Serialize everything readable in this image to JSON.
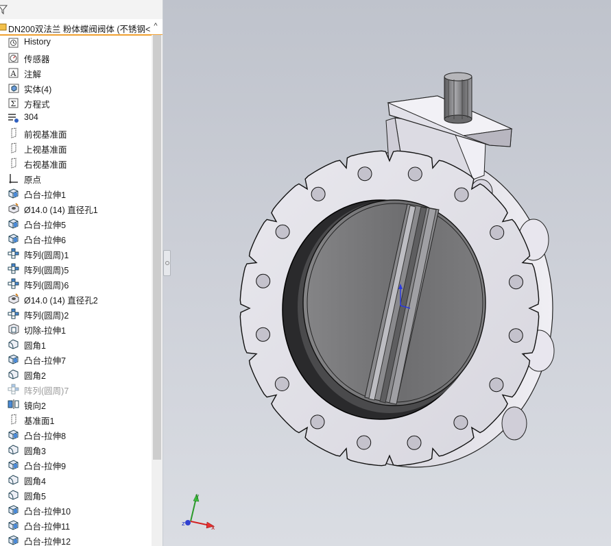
{
  "feature_tree": {
    "root_label": "DN200双法兰 粉体蝶阀阀体 (不锈钢<",
    "collapse_glyph": "^",
    "items": [
      {
        "label": "History",
        "icon": "history-icon",
        "dim": false
      },
      {
        "label": "传感器",
        "icon": "sensor-icon",
        "dim": false
      },
      {
        "label": "注解",
        "icon": "annotation-icon",
        "dim": false
      },
      {
        "label": "实体(4)",
        "icon": "solid-bodies-icon",
        "dim": false
      },
      {
        "label": "方程式",
        "icon": "equations-icon",
        "dim": false
      },
      {
        "label": "304",
        "icon": "material-icon",
        "dim": false
      },
      {
        "label": "前视基准面",
        "icon": "plane-icon",
        "dim": false
      },
      {
        "label": "上视基准面",
        "icon": "plane-icon",
        "dim": false
      },
      {
        "label": "右视基准面",
        "icon": "plane-icon",
        "dim": false
      },
      {
        "label": "原点",
        "icon": "origin-icon",
        "dim": false
      },
      {
        "label": "凸台-拉伸1",
        "icon": "boss-extrude-icon",
        "dim": false
      },
      {
        "label": "Ø14.0 (14) 直径孔1",
        "icon": "hole-wizard-icon",
        "dim": false
      },
      {
        "label": "凸台-拉伸5",
        "icon": "boss-extrude-icon",
        "dim": false
      },
      {
        "label": "凸台-拉伸6",
        "icon": "boss-extrude-icon",
        "dim": false
      },
      {
        "label": "阵列(圆周)1",
        "icon": "circular-pattern-icon",
        "dim": false
      },
      {
        "label": "阵列(圆周)5",
        "icon": "circular-pattern-icon",
        "dim": false
      },
      {
        "label": "阵列(圆周)6",
        "icon": "circular-pattern-icon",
        "dim": false
      },
      {
        "label": "Ø14.0 (14) 直径孔2",
        "icon": "hole-wizard-icon",
        "dim": false
      },
      {
        "label": "阵列(圆周)2",
        "icon": "circular-pattern-icon",
        "dim": false
      },
      {
        "label": "切除-拉伸1",
        "icon": "cut-extrude-icon",
        "dim": false
      },
      {
        "label": "圆角1",
        "icon": "fillet-icon",
        "dim": false
      },
      {
        "label": "凸台-拉伸7",
        "icon": "boss-extrude-icon",
        "dim": false
      },
      {
        "label": "圆角2",
        "icon": "fillet-icon",
        "dim": false
      },
      {
        "label": "阵列(圆周)7",
        "icon": "circular-pattern-icon",
        "dim": true
      },
      {
        "label": "镜向2",
        "icon": "mirror-icon",
        "dim": false
      },
      {
        "label": "基准面1",
        "icon": "plane-icon",
        "dim": false
      },
      {
        "label": "凸台-拉伸8",
        "icon": "boss-extrude-icon",
        "dim": false
      },
      {
        "label": "圆角3",
        "icon": "fillet-icon",
        "dim": false
      },
      {
        "label": "凸台-拉伸9",
        "icon": "boss-extrude-icon",
        "dim": false
      },
      {
        "label": "圆角4",
        "icon": "fillet-icon",
        "dim": false
      },
      {
        "label": "圆角5",
        "icon": "fillet-icon",
        "dim": false
      },
      {
        "label": "凸台-拉伸10",
        "icon": "boss-extrude-icon",
        "dim": false
      },
      {
        "label": "凸台-拉伸11",
        "icon": "boss-extrude-icon",
        "dim": false
      },
      {
        "label": "凸台-拉伸12",
        "icon": "boss-extrude-icon",
        "dim": false
      }
    ]
  },
  "triad": {
    "x_label": "x",
    "y_label": "y",
    "z_label": "z"
  },
  "colors": {
    "accent": "#f0a030",
    "viewport_bg": "#c8ccd4",
    "part_face": "#e4e3ea",
    "disc_face": "#7a7a7c"
  }
}
